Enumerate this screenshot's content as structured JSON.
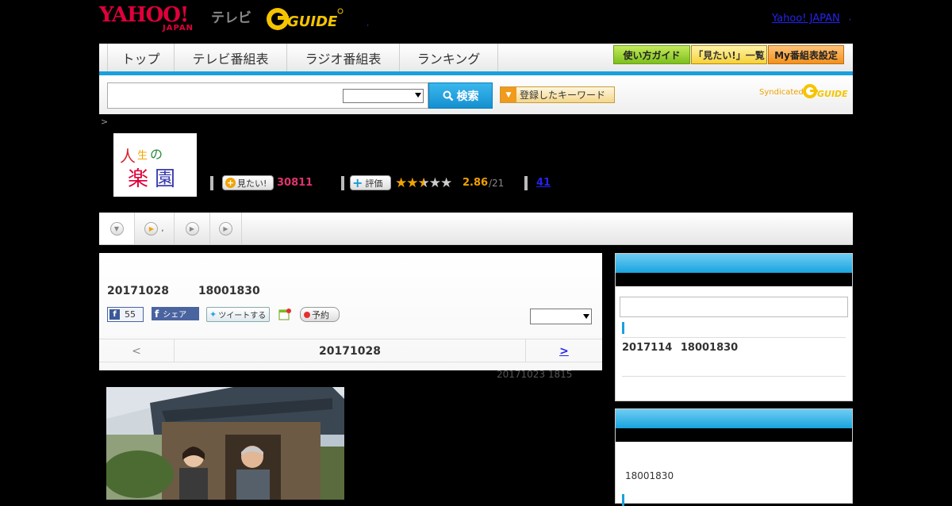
{
  "header": {
    "yahoo_logo": "YAHOO!",
    "yahoo_logo_sub": "JAPAN",
    "tv_label": "テレビ",
    "gguide_logo": "G-GUIDE",
    "top_link": "Yahoo! JAPAN",
    "dot_left": ",",
    "dot_right": ","
  },
  "nav": {
    "items": [
      "トップ",
      "テレビ番組表",
      "ラジオ番組表",
      "ランキング"
    ],
    "right_buttons": [
      "使い方ガイド",
      "「見たい!」一覧",
      "My番組表設定"
    ]
  },
  "search": {
    "button_label": "検索",
    "keyword_button": "登録したキーワード",
    "syndicated": "Syndicated"
  },
  "breadcrumb": ">",
  "program": {
    "logo_text": "人生の楽園",
    "want_label": "見たい!",
    "want_count": "30811",
    "rate_label": "評価",
    "rating": "2.86",
    "rating_count": "/21",
    "reviews_link": "41"
  },
  "tabs": [
    {
      "label": ""
    },
    {
      "label": ","
    },
    {
      "label": ""
    },
    {
      "label": ""
    }
  ],
  "main": {
    "date": "20171028",
    "time": "18001830",
    "fb_like_count": "55",
    "fb_share": "シェア",
    "tweet": "ツイートする",
    "reserve": "予約",
    "nav_prev": "<",
    "nav_date": "20171028",
    "nav_next": ">",
    "updated": "20171023  1815"
  },
  "side": {
    "upcoming_date": "2017114",
    "upcoming_time": "18001830",
    "panel2_time": "18001830"
  },
  "colors": {
    "accent_blue": "#1aa0dc",
    "want_pink": "#e0336e",
    "rating_orange": "#f0a000",
    "link_blue": "#2323ee"
  }
}
